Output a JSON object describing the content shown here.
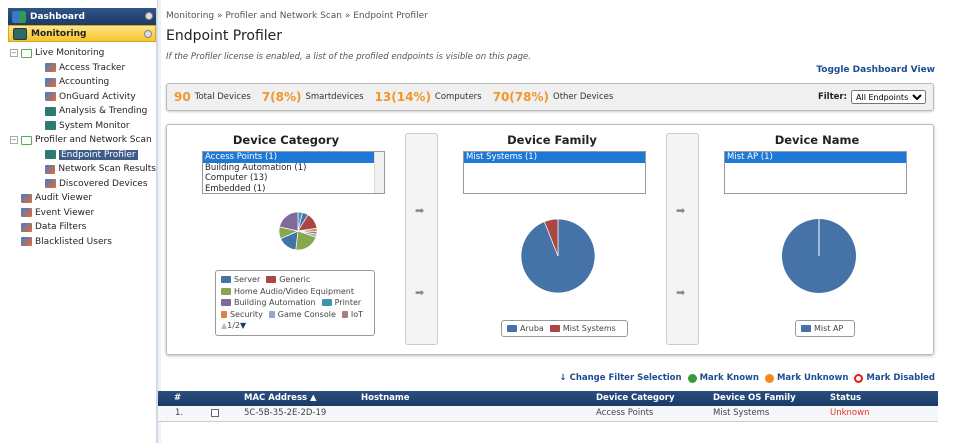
{
  "sidebar": {
    "dashboard": "Dashboard",
    "monitoring": "Monitoring",
    "items": [
      {
        "label": "Live Monitoring",
        "level": 0,
        "icon": "live",
        "expander": true
      },
      {
        "label": "Access Tracker",
        "level": 1,
        "icon": "net"
      },
      {
        "label": "Accounting",
        "level": 1,
        "icon": "net"
      },
      {
        "label": "OnGuard Activity",
        "level": 1,
        "icon": "net"
      },
      {
        "label": "Analysis & Trending",
        "level": 1,
        "icon": "chart"
      },
      {
        "label": "System Monitor",
        "level": 1,
        "icon": "chart"
      },
      {
        "label": "Profiler and Network Scan",
        "level": 0,
        "icon": "live",
        "expander": true
      },
      {
        "label": "Endpoint Profiler",
        "level": 1,
        "icon": "chart",
        "selected": true
      },
      {
        "label": "Network Scan Results",
        "level": 1,
        "icon": "net"
      },
      {
        "label": "Discovered Devices",
        "level": 1,
        "icon": "net"
      },
      {
        "label": "Audit Viewer",
        "level": 0,
        "icon": "net"
      },
      {
        "label": "Event Viewer",
        "level": 0,
        "icon": "net"
      },
      {
        "label": "Data Filters",
        "level": 0,
        "icon": "net"
      },
      {
        "label": "Blacklisted Users",
        "level": 0,
        "icon": "net"
      }
    ]
  },
  "main": {
    "breadcrumb": "Monitoring » Profiler and Network Scan » Endpoint Profiler",
    "title": "Endpoint Profiler",
    "description": "If the Profiler license is enabled, a list of the profiled endpoints is visible on this page.",
    "toggle": "Toggle Dashboard View",
    "stats": [
      {
        "n": "90",
        "l": "Total Devices"
      },
      {
        "n": "7(8%)",
        "l": "Smartdevices"
      },
      {
        "n": "13(14%)",
        "l": "Computers"
      },
      {
        "n": "70(78%)",
        "l": "Other Devices"
      }
    ],
    "filter_label": "Filter:",
    "filter_value": "All Endpoints",
    "category": {
      "title": "Device Category",
      "items": [
        "Access Points (1)",
        "Building Automation (1)",
        "Computer (13)",
        "Embedded (1)"
      ],
      "legend": [
        "Server",
        "Generic",
        "Home Audio/Video Equipment",
        "Building Automation",
        "Printer",
        "Security",
        "Game Console",
        "IoT"
      ],
      "legend_colors": [
        "#4572a7",
        "#aa4643",
        "#89a54e",
        "#80699b",
        "#3d96ae",
        "#db843d",
        "#92a8cd",
        "#a47d7c"
      ],
      "pager": "1/2"
    },
    "family": {
      "title": "Device Family",
      "items": [
        "Mist Systems (1)"
      ],
      "legend": [
        "Aruba",
        "Mist Systems"
      ],
      "legend_colors": [
        "#4572a7",
        "#aa4643"
      ]
    },
    "name": {
      "title": "Device Name",
      "items": [
        "Mist AP (1)"
      ],
      "legend": [
        "Mist AP"
      ],
      "legend_colors": [
        "#4572a7"
      ]
    },
    "actions": {
      "change": "Change Filter Selection",
      "known": "Mark Known",
      "unknown": "Mark Unknown",
      "disabled": "Mark Disabled"
    },
    "table": {
      "headers": [
        "#",
        "MAC Address ▲",
        "Hostname",
        "Device Category",
        "Device OS Family",
        "Status"
      ],
      "rows": [
        {
          "num": "1.",
          "mac": "5C-5B-35-2E-2D-19",
          "host": "",
          "category": "Access Points",
          "os": "Mist Systems",
          "status": "Unknown"
        }
      ]
    }
  },
  "chart_data": [
    {
      "type": "pie",
      "slices": [
        {
          "label": "Printer",
          "value": 3
        },
        {
          "label": "Server",
          "value": 4
        },
        {
          "label": "Generic",
          "value": 11
        },
        {
          "label": "Security",
          "value": 2
        },
        {
          "label": "IoT",
          "value": 2
        },
        {
          "label": "Game Console",
          "value": 2
        },
        {
          "label": "Home Audio/Video Equipment",
          "value": 17
        },
        {
          "label": "Server",
          "value": 13
        },
        {
          "label": "Home Audio/Video Equipment",
          "value": 8
        },
        {
          "label": "Building Automation",
          "value": 17
        }
      ]
    },
    {
      "type": "pie",
      "slices": [
        {
          "label": "Aruba",
          "value": 94
        },
        {
          "label": "Mist Systems",
          "value": 6
        }
      ]
    },
    {
      "type": "pie",
      "slices": [
        {
          "label": "Mist AP",
          "value": 100
        }
      ]
    }
  ]
}
